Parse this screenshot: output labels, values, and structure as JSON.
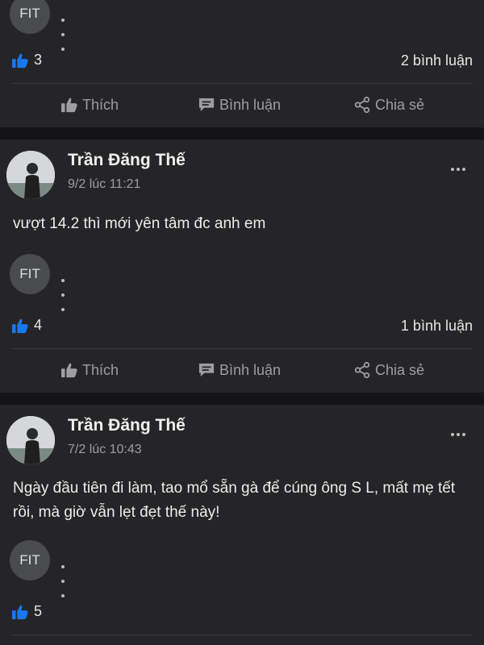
{
  "posts": [
    {
      "author": "",
      "timestamp": "",
      "content": "",
      "badge": "FIT",
      "likes": "3",
      "comments": "2 bình luận"
    },
    {
      "author": "Trần Đăng Thế",
      "timestamp": "9/2 lúc 11:21",
      "content": "vượt 14.2 thì mới yên tâm đc anh em",
      "badge": "FIT",
      "likes": "4",
      "comments": "1 bình luận"
    },
    {
      "author": "Trần Đăng Thế",
      "timestamp": "7/2 lúc 10:43",
      "content": "Ngày đầu tiên đi làm, tao mổ sẵn gà để cúng ông S L, mất mẹ tết rồi, mà giờ vẫn lẹt đẹt thế này!",
      "badge": "FIT",
      "likes": "5",
      "comments": ""
    }
  ],
  "actions": {
    "like_label": "Thích",
    "comment_label": "Bình luận",
    "share_label": "Chia sẻ"
  },
  "colors": {
    "background": "#17181a",
    "card": "#252527",
    "like_blue": "#1877f2",
    "muted": "#9d9ea2"
  },
  "icons": {
    "reaction": "thumbs-up-icon",
    "like": "thumbs-up-outline-icon",
    "comment": "comment-icon",
    "share": "share-icon",
    "more": "more-dots-icon"
  }
}
